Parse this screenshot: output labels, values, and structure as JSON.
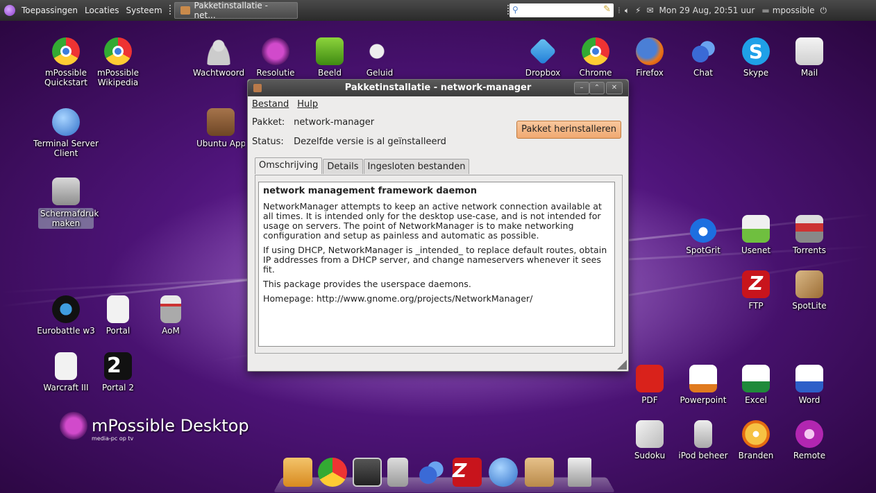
{
  "top_panel": {
    "menus": [
      "Toepassingen",
      "Locaties",
      "Systeem"
    ],
    "task_label": "Pakketinstallatie - net...",
    "search_value": "",
    "datetime": "Mon 29 Aug, 20:51 uur",
    "username": "mpossible"
  },
  "desktop": {
    "left_icons": [
      {
        "label": "mPossible Quickstart",
        "icon": "chrome-icon"
      },
      {
        "label": "mPossible Wikipedia",
        "icon": "chrome-icon"
      },
      {
        "label": "Wachtwoord",
        "icon": "person-icon"
      },
      {
        "label": "Resolutie",
        "icon": "mpossible-icon"
      },
      {
        "label": "Beeld",
        "icon": "nvidia-icon"
      },
      {
        "label": "Geluid",
        "icon": "speaker-icon"
      },
      {
        "label": "Terminal Server Client",
        "icon": "terminal-globe-icon"
      },
      {
        "label": "Ubuntu Apps",
        "icon": "box-icon"
      },
      {
        "label": "Schermafdruk maken",
        "icon": "camera-icon"
      },
      {
        "label": "Eurobattle w3",
        "icon": "eurobattle-icon"
      },
      {
        "label": "Portal",
        "icon": "file-icon"
      },
      {
        "label": "AoM",
        "icon": "aom-icon"
      },
      {
        "label": "Warcraft III",
        "icon": "file-icon"
      },
      {
        "label": "Portal 2",
        "icon": "portal2-icon"
      }
    ],
    "right_icons": [
      {
        "label": "Dropbox",
        "icon": "dropbox-icon"
      },
      {
        "label": "Chrome",
        "icon": "chrome-icon"
      },
      {
        "label": "Firefox",
        "icon": "firefox-icon"
      },
      {
        "label": "Chat",
        "icon": "chat-icon"
      },
      {
        "label": "Skype",
        "icon": "skype-icon"
      },
      {
        "label": "Mail",
        "icon": "mail-icon"
      },
      {
        "label": "SpotGrit",
        "icon": "spotgrit-icon"
      },
      {
        "label": "Usenet",
        "icon": "news-icon"
      },
      {
        "label": "Torrents",
        "icon": "torrent-icon"
      },
      {
        "label": "FTP",
        "icon": "filezilla-icon"
      },
      {
        "label": "SpotLite",
        "icon": "map-icon"
      },
      {
        "label": "PDF",
        "icon": "pdf-icon"
      },
      {
        "label": "Powerpoint",
        "icon": "powerpoint-icon"
      },
      {
        "label": "Excel",
        "icon": "excel-icon"
      },
      {
        "label": "Word",
        "icon": "word-icon"
      },
      {
        "label": "Sudoku",
        "icon": "sudoku-icon"
      },
      {
        "label": "iPod beheer",
        "icon": "ipod-icon"
      },
      {
        "label": "Branden",
        "icon": "burn-icon"
      },
      {
        "label": "Remote",
        "icon": "remote-icon"
      }
    ],
    "logo": {
      "title": "mPossible Desktop",
      "subtitle": "media-pc op tv"
    }
  },
  "dialog": {
    "title": "Pakketinstallatie - network-manager",
    "menu": [
      "Bestand",
      "Hulp"
    ],
    "package_key": "Pakket:",
    "package_value": "network-manager",
    "status_key": "Status:",
    "status_value": "Dezelfde versie is al geïnstalleerd",
    "install_button": "Pakket herinstalleren",
    "tabs": [
      "Omschrijving",
      "Details",
      "Ingesloten bestanden"
    ],
    "description": {
      "heading": "network management framework daemon",
      "paragraphs": [
        "NetworkManager attempts to keep an active network connection available at all times. It is intended only for the desktop use-case, and is not intended for usage on servers. The point of NetworkManager is to make networking configuration and setup as painless and automatic as possible.",
        "If using DHCP, NetworkManager is _intended_ to replace default routes, obtain IP addresses from a DHCP server, and change nameservers whenever it sees fit.",
        "This package provides the userspace daemons.",
        "Homepage: http://www.gnome.org/projects/NetworkManager/"
      ]
    }
  },
  "dock": {
    "items": [
      "anchor-icon",
      "chrome-icon",
      "terminal-icon",
      "disk-icon",
      "chat-icon",
      "filezilla-icon",
      "terminal-globe-icon",
      "package-icon",
      "trash-icon"
    ]
  },
  "colors": {
    "desktop_purple": "#4e1479",
    "install_button": "#f0a971",
    "panel": "#2a2a2a"
  }
}
